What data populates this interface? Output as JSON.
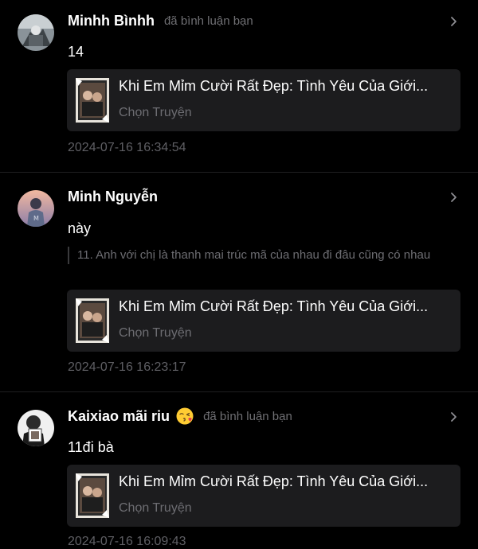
{
  "notifications": [
    {
      "user_name": "Minhh Bìnhh",
      "action": "đã bình luận bạn",
      "comment": "14",
      "quote": "",
      "story": {
        "title": "Khi Em Mỉm Cười Rất Đẹp: Tình Yêu Của Giới...",
        "subtitle": "Chọn Truyện"
      },
      "timestamp": "2024-07-16 16:34:54",
      "avatar": "avatar-photo"
    },
    {
      "user_name": "Minh Nguyễn",
      "action": "",
      "comment": "này",
      "quote": "11. Anh với chị là thanh mai trúc mã của nhau đi đâu cũng có nhau",
      "story": {
        "title": "Khi Em Mỉm Cười Rất Đẹp: Tình Yêu Của Giới...",
        "subtitle": "Chọn Truyện"
      },
      "timestamp": "2024-07-16 16:23:17",
      "avatar": "avatar-photo"
    },
    {
      "user_name": "Kaixiao mãi riu",
      "emoji": "kissing-face-emoji",
      "action": "đã bình luận bạn",
      "comment": "11đi bà",
      "quote": "",
      "story": {
        "title": "Khi Em Mỉm Cười Rất Đẹp: Tình Yêu Của Giới...",
        "subtitle": "Chọn Truyện"
      },
      "timestamp": "2024-07-16 16:09:43",
      "avatar": "avatar-photo"
    }
  ],
  "colors": {
    "background": "#000000",
    "card": "#1c1c1e",
    "muted_text": "#6d6d72",
    "divider": "#1f1f21"
  }
}
